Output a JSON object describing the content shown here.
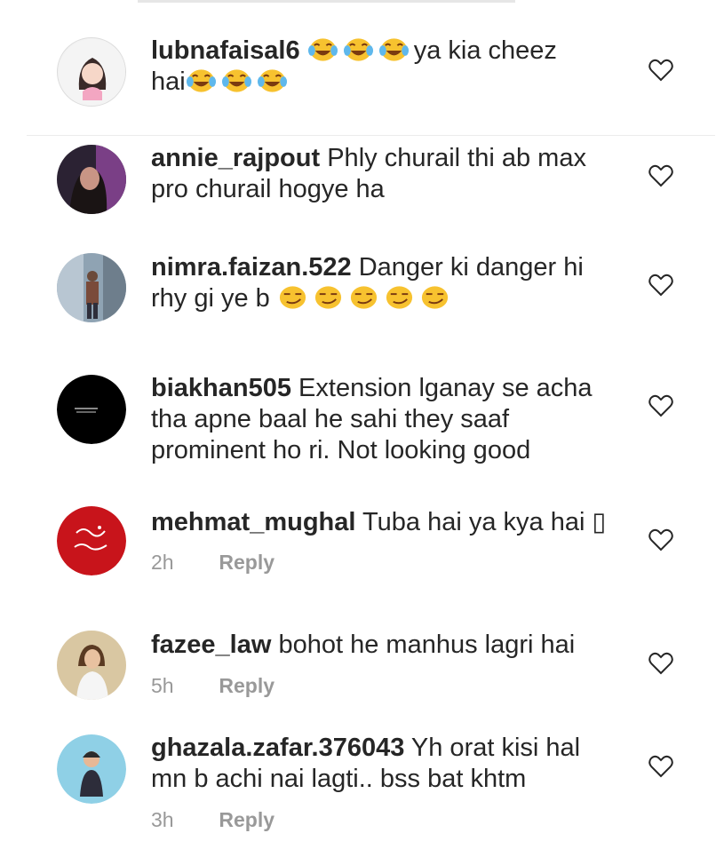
{
  "colors": {
    "text": "#262626",
    "meta": "#999999",
    "heart_stroke": "#262626",
    "emoji_face": "#f7c22f"
  },
  "icons": {
    "like": "heart-outline-icon",
    "laugh": "face-with-tears-of-joy-icon",
    "smirk": "smirking-face-icon"
  },
  "comments": [
    {
      "username": "lubnafaisal6",
      "line1_emoji": "face-with-tears-of-joy x3",
      "text_a": "ya kia cheez",
      "text_b": "hai"
    },
    {
      "username": "annie_rajpout",
      "text": "Phly churail thi ab max pro churail hogye ha"
    },
    {
      "username": "nimra.faizan.522",
      "text": "Danger ki danger hi rhy gi ye b"
    },
    {
      "username": "biakhan505",
      "text": "Extension lganay se acha tha apne baal he sahi they saaf prominent ho ri. Not looking good"
    },
    {
      "username": "mehmat_mughal",
      "text": "Tuba hai ya kya hai ▯",
      "time": "2h",
      "reply": "Reply"
    },
    {
      "username": "fazee_law",
      "text": "bohot he manhus lagri hai",
      "time": "5h",
      "reply": "Reply"
    },
    {
      "username": "ghazala.zafar.376043",
      "text": "Yh orat kisi hal mn b achi nai lagti.. bss bat khtm",
      "time": "3h",
      "reply": "Reply"
    }
  ]
}
